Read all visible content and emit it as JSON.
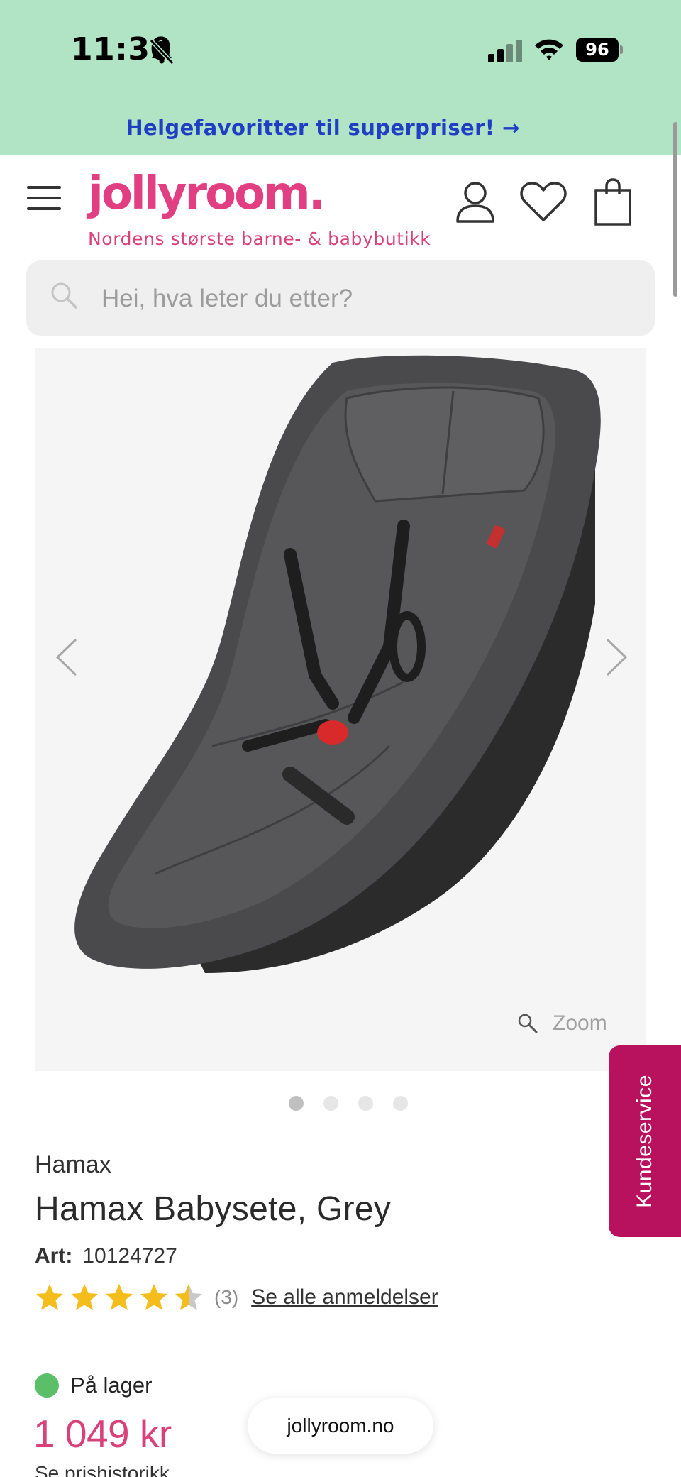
{
  "status_bar": {
    "time": "11:30",
    "battery": "96",
    "icons": [
      "bell-muted-icon",
      "cellular-signal-icon",
      "wifi-icon",
      "battery-icon"
    ]
  },
  "promo": {
    "text": "Helgefavoritter til superpriser! →"
  },
  "header": {
    "logo": "jollyroom.",
    "tagline": "Nordens største barne- & babybutikk",
    "icons": [
      "menu-icon",
      "account-icon",
      "heart-icon",
      "shopping-bag-icon"
    ]
  },
  "search": {
    "placeholder": "Hei, hva leter du etter?"
  },
  "gallery": {
    "zoom_label": "Zoom",
    "slide_count": 4,
    "active_slide": 1
  },
  "support": {
    "label": "Kundeservice"
  },
  "product": {
    "brand": "Hamax",
    "title": "Hamax Babysete, Grey",
    "art_label": "Art:",
    "art_number": "10124727",
    "rating_value": 4.5,
    "rating_max": 5,
    "review_count": "(3)",
    "reviews_link": "Se alle anmeldelser",
    "stock_label": "På lager",
    "price": "1 049 kr",
    "price_history_link": "Se prishistorikk"
  },
  "browser": {
    "url": "jollyroom.no"
  },
  "colors": {
    "banner": "#b1e4c5",
    "brand_pink": "#e23f82",
    "support_tab": "#b8115d",
    "promo_text": "#1f3ec4",
    "stock_green": "#5bbf6a",
    "star_yellow": "#f5bd1b"
  }
}
